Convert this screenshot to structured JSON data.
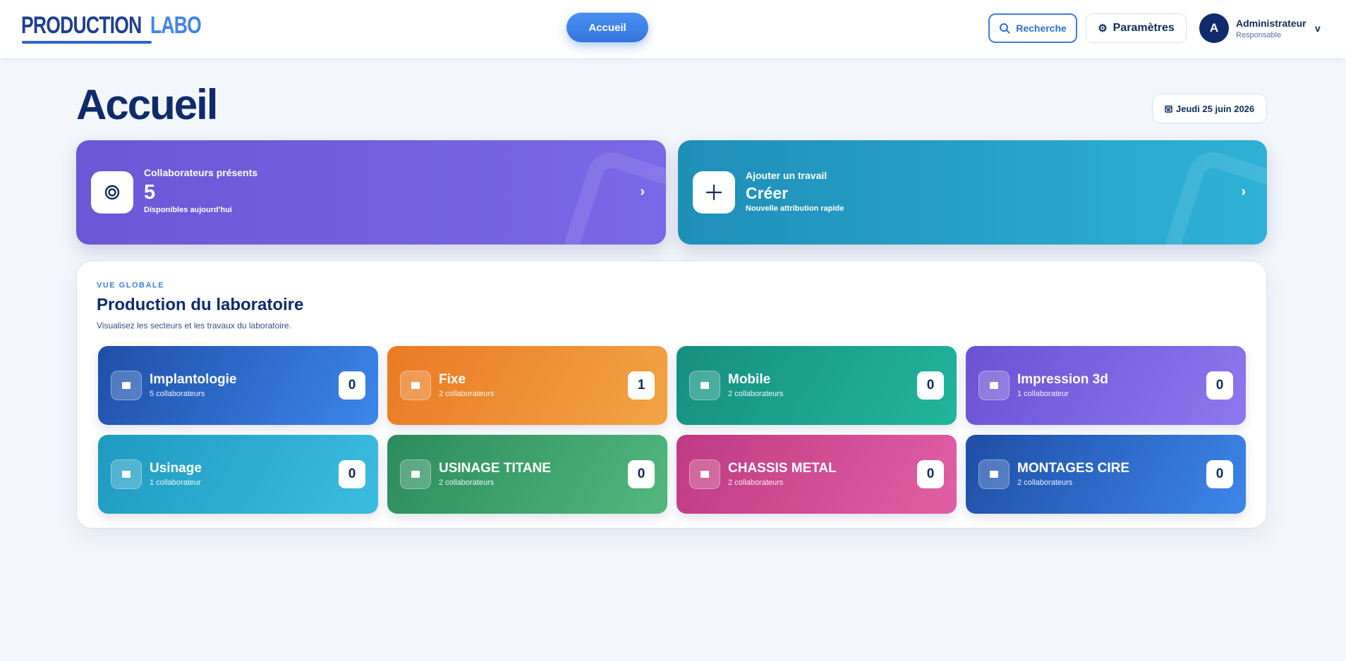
{
  "header": {
    "logo": {
      "word1": "PRODUCTION",
      "word2": "LABO"
    },
    "nav_home_label": "Accueil",
    "search_label": "Recherche",
    "settings_label": "Paramètres",
    "user": {
      "initial": "A",
      "name": "Administrateur",
      "role": "Responsable",
      "chevron": "v"
    }
  },
  "page": {
    "title": "Accueil",
    "date": "Jeudi 25 juin 2026"
  },
  "cards": {
    "collaborators": {
      "label": "Collaborateurs présents",
      "value": "5",
      "sub": "Disponibles aujourd'hui",
      "icon": "target-icon",
      "color_from": "#6c57d6",
      "color_to": "#7b68e6"
    },
    "create": {
      "label": "Ajouter un travail",
      "value": "Créer",
      "sub": "Nouvelle attribution rapide",
      "icon": "plus-icon",
      "color_from": "#1e8fb8",
      "color_to": "#2fb1d6"
    }
  },
  "production": {
    "eyebrow": "VUE GLOBALE",
    "title": "Production du laboratoire",
    "description": "Visualisez les secteurs et les travaux du laboratoire.",
    "sectors": [
      {
        "name": "Implantologie",
        "collaborators": "5 collaborateurs",
        "count": "0",
        "color_from": "#1f4fa8",
        "color_to": "#3d86ea"
      },
      {
        "name": "Fixe",
        "collaborators": "2 collaborateurs",
        "count": "1",
        "color_from": "#ea7a24",
        "color_to": "#f2a445"
      },
      {
        "name": "Mobile",
        "collaborators": "2 collaborateurs",
        "count": "0",
        "color_from": "#168f80",
        "color_to": "#22b59d"
      },
      {
        "name": "Impression 3d",
        "collaborators": "1 collaborateur",
        "count": "0",
        "color_from": "#6a52d4",
        "color_to": "#8e78ee"
      },
      {
        "name": "Usinage",
        "collaborators": "1 collaborateur",
        "count": "0",
        "color_from": "#1f9ac0",
        "color_to": "#3cbde0"
      },
      {
        "name": "USINAGE TITANE",
        "collaborators": "2 collaborateurs",
        "count": "0",
        "color_from": "#2a8c5c",
        "color_to": "#52b87c"
      },
      {
        "name": "CHASSIS METAL",
        "collaborators": "2 collaborateurs",
        "count": "0",
        "color_from": "#bf3a82",
        "color_to": "#e060a6"
      },
      {
        "name": "MONTAGES CIRE",
        "collaborators": "2 collaborateurs",
        "count": "0",
        "color_from": "#1e4ea6",
        "color_to": "#3d86ea"
      }
    ]
  }
}
